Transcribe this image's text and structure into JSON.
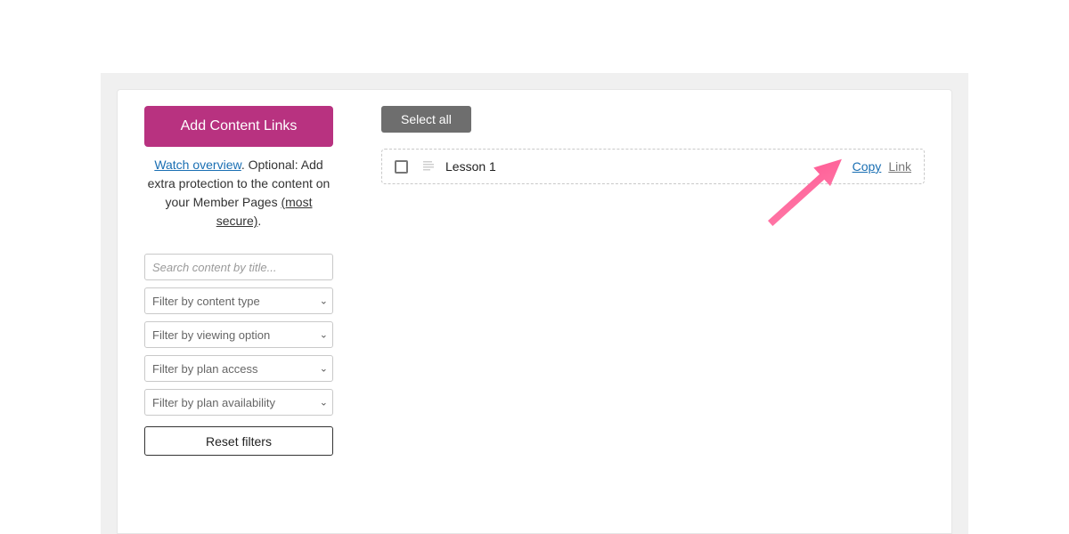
{
  "sidebar": {
    "add_button_label": "Add Content Links",
    "watch_link_text": "Watch overview",
    "desc_middle": ". Optional: Add extra protection to the content on your Member Pages ",
    "most_secure_text": "(most secure)",
    "desc_end": ".",
    "search_placeholder": "Search content by title...",
    "filter_content_type_placeholder": "Filter by content type",
    "filter_viewing_option_placeholder": "Filter by viewing option",
    "filter_plan_access_placeholder": "Filter by plan access",
    "filter_plan_availability_placeholder": "Filter by plan availability",
    "reset_label": "Reset filters"
  },
  "main": {
    "select_all_label": "Select all",
    "items": [
      {
        "title": "Lesson 1",
        "copy_label": "Copy",
        "link_label": "Link"
      }
    ]
  }
}
